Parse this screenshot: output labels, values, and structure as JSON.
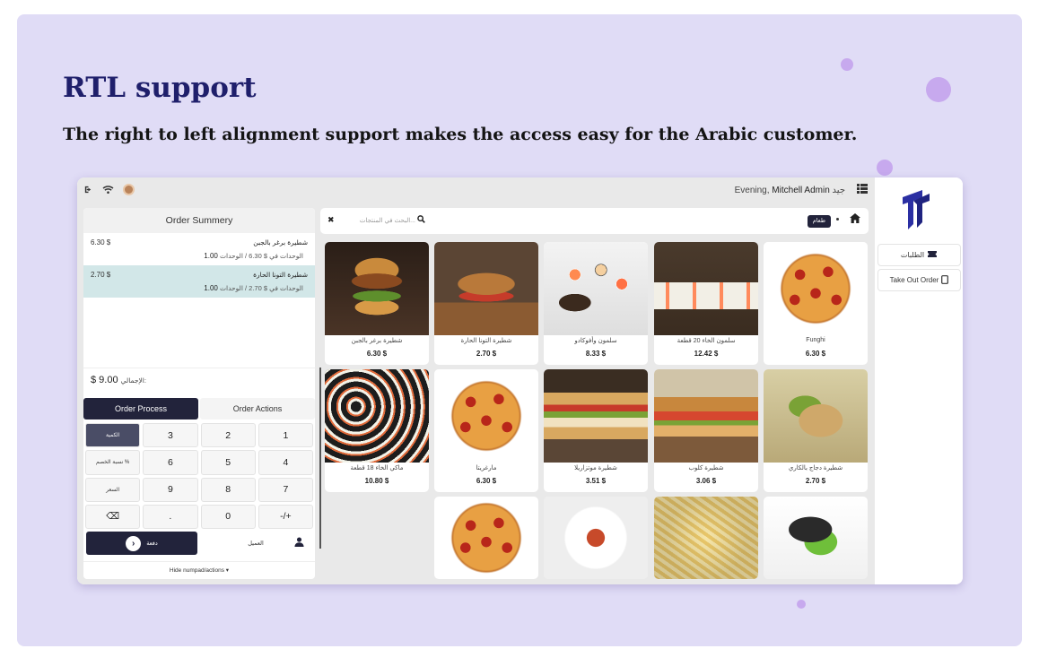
{
  "hero": {
    "title": "RTL support",
    "subtitle": "The right to left alignment support makes the access easy for the Arabic customer."
  },
  "topbar": {
    "greeting_prefix": "Evening,",
    "user_name": "Mitchell Admin",
    "greeting_suffix": "جيد",
    "icons": [
      "logout-icon",
      "wifi-icon",
      "avatar",
      "list-icon"
    ]
  },
  "order": {
    "title": "Order Summery",
    "lines": [
      {
        "name": "شطيرة برغر بالجبن",
        "price": "6.30 $",
        "qty": "1.00",
        "unit": "الوحدات في $ 6.30 / الوحدات",
        "selected": false
      },
      {
        "name": "شطيرة التونا الحارة",
        "price": "2.70 $",
        "qty": "1.00",
        "unit": "الوحدات في $ 2.70 / الوحدات",
        "selected": true
      }
    ],
    "total_label": "الإجمالي:",
    "total_value": "$ 9.00",
    "tabs": {
      "process": "Order Process",
      "actions": "Order Actions"
    },
    "numpad": {
      "keys": [
        "الكمية",
        "3",
        "2",
        "1",
        "نسبة الخصم %",
        "6",
        "5",
        "4",
        "السعر",
        "9",
        "8",
        "7",
        "⌫",
        ".",
        "0",
        "-/+"
      ]
    },
    "pay_label": "دفعة",
    "customer_label": "العميل",
    "hide_label": "Hide numpad/actions ▾"
  },
  "search": {
    "placeholder": "البحث في المنتجات...",
    "breadcrumb": "طعام"
  },
  "products": [
    {
      "name": "شطيرة برغر بالجبن",
      "price": "6.30 $",
      "img": "img-burger"
    },
    {
      "name": "شطيرة التونا الحارة",
      "price": "2.70 $",
      "img": "img-sandwich"
    },
    {
      "name": "سلمون وأفوكادو",
      "price": "8.33 $",
      "img": "img-sushi"
    },
    {
      "name": "سلمون الخاء 20 قطعة",
      "price": "12.42 $",
      "img": "img-sushi2"
    },
    {
      "name": "Funghi",
      "price": "6.30 $",
      "img": "img-pizza"
    },
    {
      "name": "ماكي الخاء 18 قطعة",
      "price": "10.80 $",
      "img": "img-maki"
    },
    {
      "name": "مارغريتا",
      "price": "6.30 $",
      "img": "img-pizza"
    },
    {
      "name": "شطيرة موتزاريلا",
      "price": "3.51 $",
      "img": "img-club"
    },
    {
      "name": "شطيرة كلوب",
      "price": "3.06 $",
      "img": "img-baguette"
    },
    {
      "name": "شطيرة دجاج بالكاري",
      "price": "2.70 $",
      "img": "img-wrap"
    },
    {
      "name": "",
      "price": "",
      "img": "img-pizza"
    },
    {
      "name": "",
      "price": "",
      "img": "img-pasta"
    },
    {
      "name": "",
      "price": "",
      "img": "img-penne"
    },
    {
      "name": "",
      "price": "",
      "img": "img-handroll"
    }
  ],
  "sidebar": {
    "orders_label": "الطلبات",
    "takeout_label": "Take Out Order"
  },
  "colors": {
    "accent_dark": "#22233b",
    "background": "#e0dcf6",
    "selected_line": "#d2e7e8",
    "brand_blue": "#2b2fa3"
  }
}
